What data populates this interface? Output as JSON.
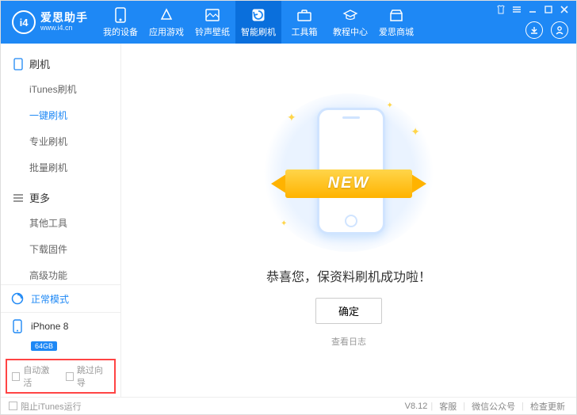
{
  "logo": {
    "badge": "i4",
    "title": "爱思助手",
    "subtitle": "www.i4.cn"
  },
  "nav": [
    {
      "label": "我的设备"
    },
    {
      "label": "应用游戏"
    },
    {
      "label": "铃声壁纸"
    },
    {
      "label": "智能刷机"
    },
    {
      "label": "工具箱"
    },
    {
      "label": "教程中心"
    },
    {
      "label": "爱思商城"
    }
  ],
  "sidebar": {
    "group1": {
      "title": "刷机",
      "items": [
        "iTunes刷机",
        "一键刷机",
        "专业刷机",
        "批量刷机"
      ]
    },
    "group2": {
      "title": "更多",
      "items": [
        "其他工具",
        "下载固件",
        "高级功能"
      ]
    },
    "mode": "正常模式",
    "device": {
      "name": "iPhone 8",
      "capacity": "64GB"
    },
    "auto_activate": "自动激活",
    "skip_guide": "跳过向导"
  },
  "main": {
    "ribbon": "NEW",
    "success": "恭喜您，保资料刷机成功啦！",
    "ok": "确定",
    "view_log": "查看日志"
  },
  "footer": {
    "block_itunes": "阻止iTunes运行",
    "version": "V8.12",
    "support": "客服",
    "wechat": "微信公众号",
    "update": "检查更新"
  }
}
